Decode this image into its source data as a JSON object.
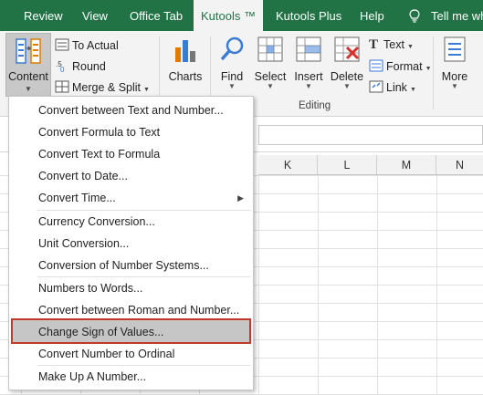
{
  "tabs": [
    "Review",
    "View",
    "Office Tab",
    "Kutools ™",
    "Kutools Plus",
    "Help"
  ],
  "tell_me": "Tell me wh",
  "ribbon": {
    "content": "Content",
    "to_actual": "To Actual",
    "round": "Round",
    "merge_split": "Merge & Split",
    "charts": "Charts",
    "find": "Find",
    "select": "Select",
    "insert": "Insert",
    "delete": "Delete",
    "text": "Text",
    "format": "Format",
    "link": "Link",
    "more": "More",
    "group_editing": "Editing"
  },
  "columns": [
    "K",
    "L",
    "M",
    "N"
  ],
  "menu": {
    "items": [
      "Convert between Text and Number...",
      "Convert Formula to Text",
      "Convert Text to Formula",
      "Convert to Date...",
      "Convert Time...",
      "Currency Conversion...",
      "Unit Conversion...",
      "Conversion of Number Systems...",
      "Numbers to Words...",
      "Convert between Roman and Number...",
      "Change Sign of Values...",
      "Convert Number to Ordinal",
      "Make Up A Number..."
    ],
    "highlighted": "Change Sign of Values..."
  },
  "colors": {
    "ribbon_green": "#217346",
    "highlight_border": "#c0392b",
    "highlight_fill": "#c6c6c6"
  }
}
